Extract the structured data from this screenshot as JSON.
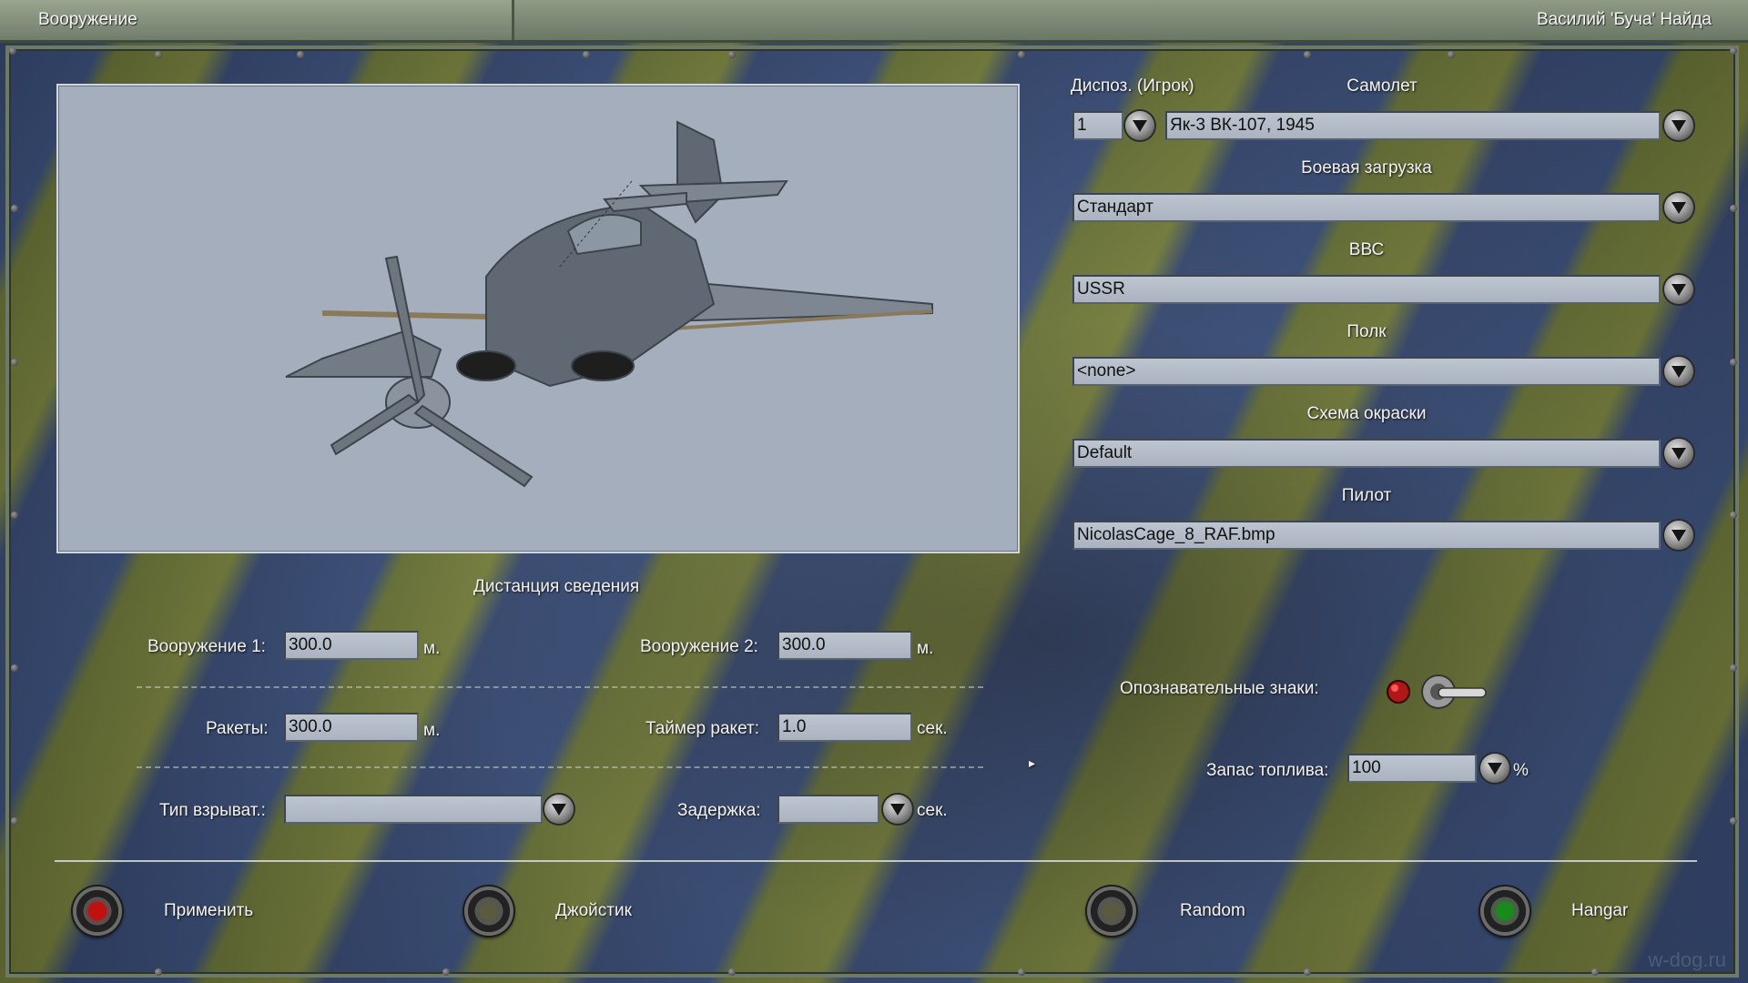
{
  "header": {
    "title": "Вооружение",
    "player": "Василий   'Буча' Найда"
  },
  "aircraft": {
    "slot_label": "Диспоз. (Игрок)",
    "slot_value": "1",
    "plane_label": "Самолет",
    "plane_value": "Як-3 ВК-107, 1945",
    "loadout_label": "Боевая загрузка",
    "loadout_value": "Стандарт",
    "airforce_label": "ВВС",
    "airforce_value": "USSR",
    "regiment_label": "Полк",
    "regiment_value": "<none>",
    "skin_label": "Схема окраски",
    "skin_value": "Default",
    "pilot_label": "Пилот",
    "pilot_value": "NicolasCage_8_RAF.bmp"
  },
  "convergence": {
    "title": "Дистанция сведения",
    "weapon1_label": "Вооружение 1:",
    "weapon1_value": "300.0",
    "weapon2_label": "Вооружение 2:",
    "weapon2_value": "300.0",
    "rockets_label": "Ракеты:",
    "rockets_value": "300.0",
    "rocket_timer_label": "Таймер ракет:",
    "rocket_timer_value": "1.0",
    "fuze_label": "Тип взрыват.:",
    "fuze_value": "",
    "delay_label": "Задержка:",
    "delay_value": "",
    "unit_m": "м.",
    "unit_sec": "сек."
  },
  "options": {
    "markings_label": "Опознавательные знаки:",
    "markings_on": true,
    "fuel_label": "Запас топлива:",
    "fuel_value": "100",
    "fuel_unit": "%"
  },
  "buttons": {
    "apply": "Применить",
    "joystick": "Джойстик",
    "random": "Random",
    "hangar": "Hangar"
  },
  "colors": {
    "apply_lamp": "#c01010",
    "joystick_lamp": "#5a5a40",
    "random_lamp": "#5a5a40",
    "hangar_lamp": "#1a8a1a",
    "viewport": "#a4aebd"
  },
  "watermark": "w-dog.ru"
}
